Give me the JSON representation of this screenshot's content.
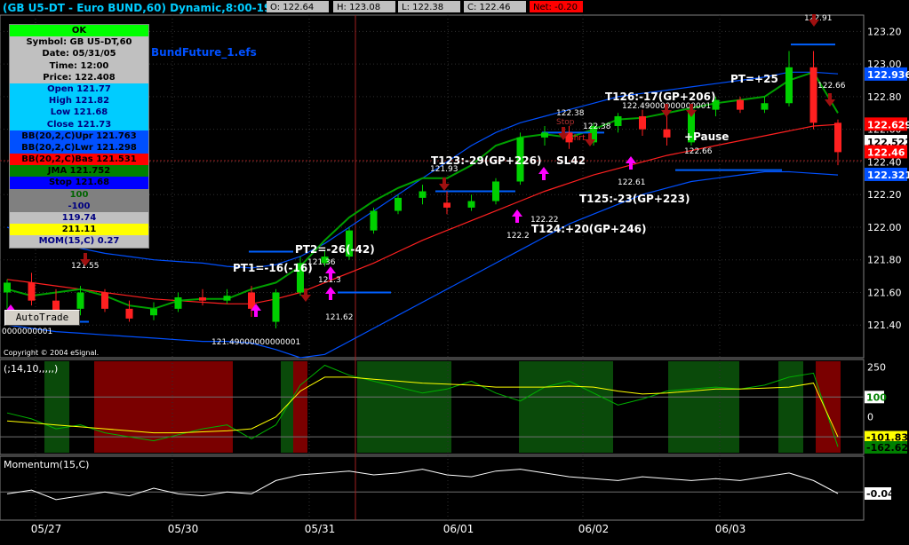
{
  "header": {
    "title": "(GB U5-DT - Euro BUND,60) Dynamic,8:00-19:00",
    "ohlc": [
      "O: 122.64",
      "H: 123.08",
      "L: 122.38",
      "C: 122.46"
    ],
    "net": "Net: -0.20"
  },
  "study_name": "BundFuture_1.efs",
  "copyright": "Copyright © 2004 eSignal.",
  "autotrade_label": "AutoTrade",
  "data_window": [
    {
      "text": "OK",
      "bg": "#00ff00",
      "fg": "#000000"
    },
    {
      "text": "Symbol: GB U5-DT,60",
      "bg": "#c0c0c0",
      "fg": "#000000"
    },
    {
      "text": "Date: 05/31/05",
      "bg": "#c0c0c0",
      "fg": "#000000"
    },
    {
      "text": "Time: 12:00",
      "bg": "#c0c0c0",
      "fg": "#000000"
    },
    {
      "text": "Price: 122.408",
      "bg": "#c0c0c0",
      "fg": "#000000"
    },
    {
      "text": "Open 121.77",
      "bg": "#00ccff",
      "fg": "#000080"
    },
    {
      "text": "High 121.82",
      "bg": "#00ccff",
      "fg": "#000080"
    },
    {
      "text": "Low 121.68",
      "bg": "#00ccff",
      "fg": "#000080"
    },
    {
      "text": "Close 121.73",
      "bg": "#00ccff",
      "fg": "#000080"
    },
    {
      "text": "BB(20,2,C)Upr 121.763",
      "bg": "#0050ff",
      "fg": "#000000"
    },
    {
      "text": "BB(20,2,C)Lwr 121.298",
      "bg": "#0050ff",
      "fg": "#000000"
    },
    {
      "text": "BB(20,2,C)Bas 121.531",
      "bg": "#ff0000",
      "fg": "#000000"
    },
    {
      "text": "JMA 121.752",
      "bg": "#008000",
      "fg": "#000000"
    },
    {
      "text": "Stop 121.68",
      "bg": "#0000ff",
      "fg": "#000000"
    },
    {
      "text": "100",
      "bg": "#808080",
      "fg": "#006400"
    },
    {
      "text": "-100",
      "bg": "#808080",
      "fg": "#000080"
    },
    {
      "text": "119.74",
      "bg": "#c0c0c0",
      "fg": "#000080"
    },
    {
      "text": "211.11",
      "bg": "#ffff00",
      "fg": "#000000"
    },
    {
      "text": "MOM(15,C) 0.27",
      "bg": "#c0c0c0",
      "fg": "#000080"
    }
  ],
  "chart_data": [
    {
      "type": "candlestick",
      "title": "(GB U5-DT - Euro BUND,60) Dynamic,8:00-19:00",
      "ylim": [
        121.2,
        123.3
      ],
      "y_ticks": [
        121.4,
        121.6,
        121.8,
        122.0,
        122.2,
        122.4,
        122.6,
        122.8,
        123.0,
        123.2
      ],
      "y_tick_labels": [
        "121.40",
        "121.60",
        "121.80",
        "122.00",
        "122.20",
        "122.40",
        "122.60",
        "122.80",
        "123.00",
        "123.20"
      ],
      "x_labels": [
        "05/27",
        "05/30",
        "05/31",
        "06/01",
        "06/02",
        "06/03"
      ],
      "crosshair": {
        "date": "05/31/05 12:00",
        "price": 122.408
      },
      "price_labels": [
        {
          "text": "122.936",
          "value": 122.936,
          "bg": "#0050ff",
          "fg": "#ffffff"
        },
        {
          "text": "122.629",
          "value": 122.629,
          "bg": "#ff0000",
          "fg": "#ffffff"
        },
        {
          "text": "122.522",
          "value": 122.522,
          "bg": "#ffffff",
          "fg": "#000000"
        },
        {
          "text": "122.46",
          "value": 122.46,
          "bg": "#ff0000",
          "fg": "#ffffff"
        },
        {
          "text": "122.321",
          "value": 122.321,
          "bg": "#0050ff",
          "fg": "#ffffff"
        }
      ],
      "series": [
        {
          "name": "BB(20,2,C)Upr",
          "color": "#0050ff",
          "values": [
            122.0,
            121.95,
            121.9,
            121.87,
            121.84,
            121.82,
            121.8,
            121.79,
            121.78,
            121.76,
            121.75,
            121.77,
            121.82,
            121.9,
            122.0,
            122.1,
            122.2,
            122.3,
            122.4,
            122.5,
            122.58,
            122.64,
            122.68,
            122.72,
            122.76,
            122.8,
            122.82,
            122.84,
            122.86,
            122.88,
            122.9,
            122.92,
            122.95,
            122.95,
            122.94
          ]
        },
        {
          "name": "BB(20,2,C)Bas",
          "color": "#ff2020",
          "values": [
            121.68,
            121.66,
            121.64,
            121.62,
            121.6,
            121.58,
            121.56,
            121.55,
            121.54,
            121.53,
            121.53,
            121.56,
            121.6,
            121.66,
            121.72,
            121.78,
            121.85,
            121.92,
            121.98,
            122.04,
            122.1,
            122.16,
            122.22,
            122.27,
            122.32,
            122.36,
            122.4,
            122.44,
            122.47,
            122.5,
            122.53,
            122.56,
            122.59,
            122.62,
            122.63
          ]
        },
        {
          "name": "BB(20,2,C)Lwr",
          "color": "#0050ff",
          "values": [
            121.4,
            121.38,
            121.36,
            121.35,
            121.34,
            121.33,
            121.32,
            121.31,
            121.3,
            121.3,
            121.29,
            121.25,
            121.2,
            121.22,
            121.3,
            121.38,
            121.46,
            121.54,
            121.62,
            121.7,
            121.78,
            121.86,
            121.94,
            122.02,
            122.08,
            122.14,
            122.2,
            122.24,
            122.28,
            122.3,
            122.32,
            122.34,
            122.34,
            122.33,
            122.32
          ]
        },
        {
          "name": "JMA",
          "color": "#00a000",
          "values": [
            121.62,
            121.58,
            121.6,
            121.62,
            121.58,
            121.52,
            121.5,
            121.55,
            121.56,
            121.56,
            121.62,
            121.66,
            121.76,
            121.92,
            122.06,
            122.16,
            122.24,
            122.3,
            122.3,
            122.38,
            122.5,
            122.55,
            122.57,
            122.55,
            122.6,
            122.66,
            122.67,
            122.7,
            122.73,
            122.76,
            122.78,
            122.8,
            122.9,
            122.95,
            122.7
          ]
        }
      ],
      "candles": [
        {
          "o": 121.6,
          "h": 121.68,
          "l": 121.5,
          "c": 121.66
        },
        {
          "o": 121.66,
          "h": 121.72,
          "l": 121.52,
          "c": 121.55
        },
        {
          "o": 121.55,
          "h": 121.62,
          "l": 121.44,
          "c": 121.48
        },
        {
          "o": 121.5,
          "h": 121.64,
          "l": 121.46,
          "c": 121.6
        },
        {
          "o": 121.6,
          "h": 121.62,
          "l": 121.48,
          "c": 121.5
        },
        {
          "o": 121.5,
          "h": 121.55,
          "l": 121.42,
          "c": 121.44
        },
        {
          "o": 121.46,
          "h": 121.54,
          "l": 121.43,
          "c": 121.5
        },
        {
          "o": 121.5,
          "h": 121.6,
          "l": 121.48,
          "c": 121.57
        },
        {
          "o": 121.57,
          "h": 121.62,
          "l": 121.52,
          "c": 121.55
        },
        {
          "o": 121.55,
          "h": 121.62,
          "l": 121.53,
          "c": 121.58
        },
        {
          "o": 121.6,
          "h": 121.64,
          "l": 121.45,
          "c": 121.5
        },
        {
          "o": 121.42,
          "h": 121.62,
          "l": 121.38,
          "c": 121.6
        },
        {
          "o": 121.6,
          "h": 121.82,
          "l": 121.58,
          "c": 121.78
        },
        {
          "o": 121.78,
          "h": 121.86,
          "l": 121.76,
          "c": 121.82
        },
        {
          "o": 121.82,
          "h": 122.0,
          "l": 121.8,
          "c": 121.98
        },
        {
          "o": 121.98,
          "h": 122.12,
          "l": 121.96,
          "c": 122.1
        },
        {
          "o": 122.1,
          "h": 122.2,
          "l": 122.08,
          "c": 122.18
        },
        {
          "o": 122.18,
          "h": 122.26,
          "l": 122.14,
          "c": 122.22
        },
        {
          "o": 122.15,
          "h": 122.22,
          "l": 122.08,
          "c": 122.12
        },
        {
          "o": 122.12,
          "h": 122.2,
          "l": 122.1,
          "c": 122.16
        },
        {
          "o": 122.16,
          "h": 122.3,
          "l": 122.14,
          "c": 122.28
        },
        {
          "o": 122.28,
          "h": 122.58,
          "l": 122.26,
          "c": 122.55
        },
        {
          "o": 122.55,
          "h": 122.62,
          "l": 122.5,
          "c": 122.58
        },
        {
          "o": 122.58,
          "h": 122.62,
          "l": 122.48,
          "c": 122.52
        },
        {
          "o": 122.52,
          "h": 122.64,
          "l": 122.5,
          "c": 122.62
        },
        {
          "o": 122.62,
          "h": 122.7,
          "l": 122.58,
          "c": 122.68
        },
        {
          "o": 122.68,
          "h": 122.72,
          "l": 122.56,
          "c": 122.6
        },
        {
          "o": 122.6,
          "h": 122.68,
          "l": 122.5,
          "c": 122.55
        },
        {
          "o": 122.52,
          "h": 122.74,
          "l": 122.5,
          "c": 122.72
        },
        {
          "o": 122.72,
          "h": 122.8,
          "l": 122.68,
          "c": 122.78
        },
        {
          "o": 122.78,
          "h": 122.8,
          "l": 122.7,
          "c": 122.72
        },
        {
          "o": 122.72,
          "h": 122.8,
          "l": 122.7,
          "c": 122.76
        },
        {
          "o": 122.76,
          "h": 123.08,
          "l": 122.74,
          "c": 122.98
        },
        {
          "o": 122.98,
          "h": 123.08,
          "l": 122.6,
          "c": 122.64
        },
        {
          "o": 122.64,
          "h": 122.66,
          "l": 122.38,
          "c": 122.46
        }
      ],
      "annotations": [
        {
          "text": "121.55",
          "color": "#ffffff"
        },
        {
          "text": "PT1=-16(-16)",
          "color": "#ffffff"
        },
        {
          "text": "PT2=-26(-42)",
          "color": "#ffffff"
        },
        {
          "text": "121.36",
          "color": "#ffffff"
        },
        {
          "text": "121.3",
          "color": "#ffffff"
        },
        {
          "text": "121.62",
          "color": "#ffffff"
        },
        {
          "text": "121.49000000000001",
          "color": "#ffffff"
        },
        {
          "text": "T123:-29(GP+226)",
          "color": "#ffffff"
        },
        {
          "text": "121.93",
          "color": "#ffffff"
        },
        {
          "text": "122.38",
          "color": "#ffffff"
        },
        {
          "text": "122.38",
          "color": "#ffffff"
        },
        {
          "text": "SL42",
          "color": "#ffffff"
        },
        {
          "text": "122.22",
          "color": "#ffffff"
        },
        {
          "text": "122.2",
          "color": "#ffffff"
        },
        {
          "text": "T124:+20(GP+246)",
          "color": "#ffffff"
        },
        {
          "text": "T125:-23(GP+223)",
          "color": "#ffffff"
        },
        {
          "text": "T126:-17(GP+206)",
          "color": "#ffffff"
        },
        {
          "text": "122.49000000000001",
          "color": "#ffffff"
        },
        {
          "text": "122.61",
          "color": "#ffffff"
        },
        {
          "text": "+Pause",
          "color": "#ffffff"
        },
        {
          "text": "122.66",
          "color": "#ffffff"
        },
        {
          "text": "PT=+25",
          "color": "#ffffff"
        },
        {
          "text": "122.91",
          "color": "#ffffff"
        },
        {
          "text": "122.66",
          "color": "#ffffff"
        },
        {
          "text": "Shrt",
          "color": "#ff2020"
        },
        {
          "text": "Stop",
          "color": "#b03030"
        },
        {
          "text": "0000000001",
          "color": "#ffffff"
        }
      ]
    },
    {
      "type": "line",
      "title": "(;14,10,,,,,)",
      "ylim": [
        -180,
        280
      ],
      "y_tick_labels": [
        "250",
        "0"
      ],
      "level_labels": [
        {
          "text": "100",
          "value": 100,
          "bg": "#ffffff",
          "fg": "#008000"
        },
        {
          "text": "-101.83",
          "value": -101.83,
          "bg": "#ffff00",
          "fg": "#000000"
        },
        {
          "text": "-162.62",
          "value": -162.62,
          "bg": "#008000",
          "fg": "#000000"
        }
      ],
      "zones": [
        {
          "state": "green"
        },
        {
          "state": "red"
        },
        {
          "state": "green"
        },
        {
          "state": "red"
        },
        {
          "state": "green"
        },
        {
          "state": "green"
        },
        {
          "state": "green"
        },
        {
          "state": "green"
        },
        {
          "state": "red"
        }
      ],
      "series": [
        {
          "name": "CCI",
          "color": "#00b000",
          "values": [
            20,
            -10,
            -60,
            -40,
            -80,
            -100,
            -120,
            -90,
            -60,
            -40,
            -110,
            -40,
            160,
            260,
            210,
            180,
            150,
            120,
            140,
            180,
            120,
            80,
            150,
            180,
            120,
            60,
            90,
            130,
            140,
            150,
            140,
            160,
            200,
            220,
            -150
          ]
        },
        {
          "name": "Average",
          "color": "#ffff00",
          "values": [
            -20,
            -30,
            -40,
            -50,
            -60,
            -70,
            -80,
            -80,
            -75,
            -70,
            -60,
            0,
            130,
            200,
            200,
            190,
            180,
            170,
            165,
            160,
            150,
            150,
            150,
            155,
            150,
            130,
            115,
            120,
            130,
            140,
            140,
            145,
            150,
            170,
            -100
          ]
        }
      ]
    },
    {
      "type": "line",
      "title": "Momentum(15,C)",
      "level_labels": [
        {
          "text": "-0.04",
          "value": -0.04,
          "bg": "#ffffff",
          "fg": "#000000"
        }
      ],
      "series": [
        {
          "name": "Momentum(15,C)",
          "color": "#ffffff",
          "values": [
            -0.05,
            0.05,
            -0.2,
            -0.1,
            0.0,
            -0.1,
            0.1,
            -0.05,
            -0.1,
            0.0,
            -0.05,
            0.3,
            0.45,
            0.5,
            0.55,
            0.45,
            0.5,
            0.6,
            0.45,
            0.4,
            0.55,
            0.6,
            0.5,
            0.4,
            0.35,
            0.3,
            0.4,
            0.35,
            0.3,
            0.35,
            0.3,
            0.4,
            0.5,
            0.3,
            -0.04
          ]
        }
      ]
    }
  ]
}
